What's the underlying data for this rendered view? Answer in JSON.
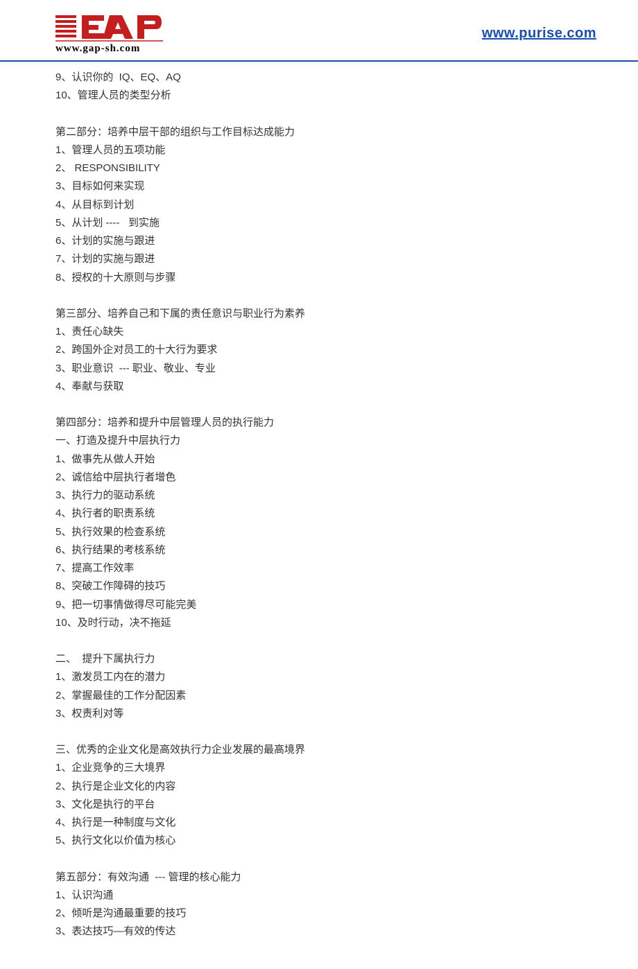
{
  "header": {
    "logo_url_text": "www.gap-sh.com",
    "right_link": "www.purise.com"
  },
  "content": {
    "intro_lines": [
      "9、认识你的  IQ、EQ、AQ",
      "10、管理人员的类型分析"
    ],
    "sections": [
      {
        "title": "第二部分：培养中层干部的组织与工作目标达成能力",
        "lines": [
          "1、管理人员的五项功能",
          "2、 RESPONSIBILITY",
          "3、目标如何来实现",
          "4、从目标到计划",
          "5、从计划 ----   到实施",
          "6、计划的实施与跟进",
          "7、计划的实施与跟进",
          "8、授权的十大原则与步骤"
        ]
      },
      {
        "title": "第三部分、培养自己和下属的责任意识与职业行为素养",
        "lines": [
          "1、责任心缺失",
          "2、跨国外企对员工的十大行为要求",
          "3、职业意识  --- 职业、敬业、专业",
          "4、奉献与获取"
        ]
      },
      {
        "title": "第四部分：培养和提升中层管理人员的执行能力",
        "lines": [
          "一、打造及提升中层执行力",
          "1、做事先从做人开始",
          "2、诚信给中层执行者增色",
          "3、执行力的驱动系统",
          "4、执行者的职责系统",
          "5、执行效果的检查系统",
          "6、执行结果的考核系统",
          "7、提高工作效率",
          "8、突破工作障碍的技巧",
          "9、把一切事情做得尽可能完美",
          "10、及时行动，决不拖延"
        ],
        "sub_blocks": [
          {
            "heading": "二、  提升下属执行力",
            "lines": [
              "1、激发员工内在的潜力",
              "2、掌握最佳的工作分配因素",
              "3、权责利对等"
            ]
          },
          {
            "heading": "三、优秀的企业文化是高效执行力企业发展的最高境界",
            "lines": [
              "1、企业竞争的三大境界",
              "2、执行是企业文化的内容",
              "3、文化是执行的平台",
              "4、执行是一种制度与文化",
              "5、执行文化以价值为核心"
            ]
          }
        ]
      },
      {
        "title": "第五部分：有效沟通  --- 管理的核心能力",
        "lines": [
          "1、认识沟通",
          "2、倾听是沟通最重要的技巧",
          "3、表达技巧—有效的传达"
        ]
      }
    ]
  }
}
